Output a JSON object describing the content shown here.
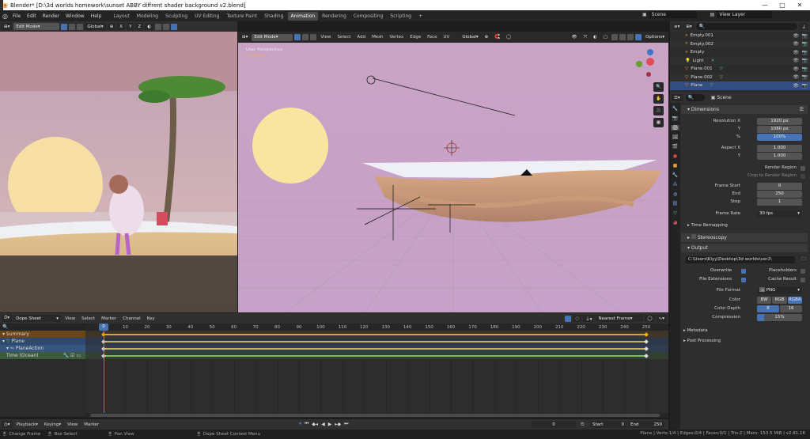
{
  "window": {
    "title": "Blender* [D:\\3d worlds homework\\sunset ABBY diffrent shader background v2.blend]",
    "minimize": "—",
    "maximize": "□",
    "close": "✕"
  },
  "menubar": {
    "menus": [
      "File",
      "Edit",
      "Render",
      "Window",
      "Help"
    ],
    "workspaces": [
      "Layout",
      "Modeling",
      "Sculpting",
      "UV Editing",
      "Texture Paint",
      "Shading",
      "Animation",
      "Rendering",
      "Compositing",
      "Scripting"
    ],
    "active_workspace": "Animation",
    "add_tab": "+",
    "scene": "Scene",
    "view_layer": "View Layer"
  },
  "left_viewport": {
    "mode": "Edit Mode",
    "orientation": "Global",
    "axes": [
      "X",
      "Y",
      "Z"
    ]
  },
  "main_viewport": {
    "mode": "Edit Mode",
    "menus": [
      "View",
      "Select",
      "Add",
      "Mesh",
      "Vertex",
      "Edge",
      "Face",
      "UV"
    ],
    "orientation": "Global",
    "options": "Options",
    "overlay_line1": "User Perspective",
    "overlay_line2": "(0) Plane"
  },
  "outliner": {
    "search_placeholder": "",
    "items": [
      {
        "name": "Empty.001",
        "type": "empty"
      },
      {
        "name": "Empty.002",
        "type": "empty"
      },
      {
        "name": "Empty",
        "type": "empty"
      },
      {
        "name": "Light",
        "type": "light"
      },
      {
        "name": "Plane.001",
        "type": "mesh"
      },
      {
        "name": "Plane.002",
        "type": "mesh"
      },
      {
        "name": "Plane",
        "type": "mesh",
        "selected": true
      }
    ]
  },
  "properties": {
    "context": "Scene",
    "dimensions": {
      "title": "Dimensions",
      "resolution_x_label": "Resolution X",
      "resolution_x": "1920 px",
      "y_label": "Y",
      "resolution_y": "1080 px",
      "pct_label": "%",
      "percent": "100%",
      "aspect_x_label": "Aspect X",
      "aspect_x": "1.000",
      "aspect_y_label": "Y",
      "aspect_y": "1.000",
      "render_region": "Render Region",
      "crop_region": "Crop to Render Region",
      "frame_start_label": "Frame Start",
      "frame_start": "0",
      "end_label": "End",
      "frame_end": "250",
      "step_label": "Step",
      "step": "1",
      "frame_rate_label": "Frame Rate",
      "frame_rate": "30 fps",
      "time_remapping": "Time Remapping"
    },
    "stereoscopy": "Stereoscopy",
    "output": {
      "title": "Output",
      "path": "C:\\Users\\Kiyy\\Desktop\\3d worlds\\ver2\\",
      "overwrite": "Overwrite",
      "placeholders": "Placeholders",
      "file_extensions": "File Extensions",
      "cache_result": "Cache Result",
      "file_format_label": "File Format",
      "file_format": "PNG",
      "color_label": "Color",
      "color_options": [
        "BW",
        "RGB",
        "RGBA"
      ],
      "color_active": "RGBA",
      "color_depth_label": "Color Depth",
      "depth_options": [
        "8",
        "16"
      ],
      "depth_active": "8",
      "compression_label": "Compression",
      "compression": "15%",
      "compression_fraction": 0.15
    },
    "metadata": "Metadata",
    "post_processing": "Post Processing"
  },
  "dopesheet": {
    "mode": "Dope Sheet",
    "menus": [
      "View",
      "Select",
      "Marker",
      "Channel",
      "Key"
    ],
    "snap": "Nearest Frame",
    "channels": [
      "Summary",
      "Plane",
      "PlaneAction",
      "Time (Ocean)"
    ],
    "ruler": [
      "0",
      "10",
      "20",
      "30",
      "40",
      "50",
      "60",
      "70",
      "80",
      "90",
      "100",
      "110",
      "120",
      "130",
      "140",
      "150",
      "160",
      "170",
      "180",
      "190",
      "200",
      "210",
      "220",
      "230",
      "240",
      "250"
    ],
    "current_frame": "0"
  },
  "timeline": {
    "menus": [
      "Playback",
      "Keying",
      "View",
      "Marker"
    ],
    "current_frame": "0",
    "start_label": "Start",
    "start": "0",
    "end_label": "End",
    "end": "250"
  },
  "status": {
    "left": [
      "Change Frame",
      "Box Select",
      "Pan View",
      "Dope Sheet Context Menu"
    ],
    "right": "Plane | Verts:1/4 | Edges:0/4 | Faces:0/1 | Tris:2 | Mem: 153.5 MiB | v2.81.16"
  }
}
